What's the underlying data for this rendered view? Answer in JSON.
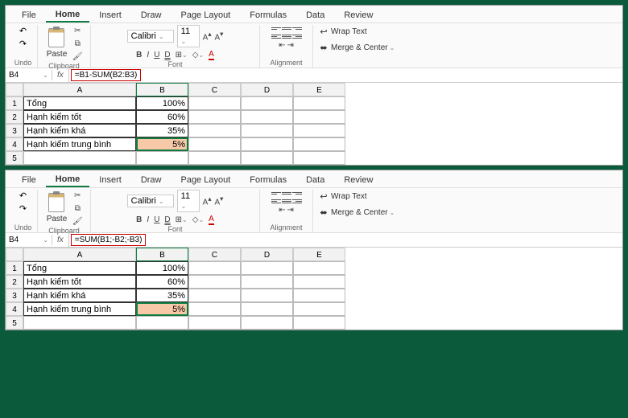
{
  "panels": [
    {
      "tabs": {
        "file": "File",
        "home": "Home",
        "insert": "Insert",
        "draw": "Draw",
        "layout": "Page Layout",
        "formulas": "Formulas",
        "data": "Data",
        "review": "Review"
      },
      "ribbon": {
        "undo": "Undo",
        "clipboard": "Clipboard",
        "paste": "Paste",
        "font_group": "Font",
        "alignment": "Alignment",
        "font_name": "Calibri",
        "font_size": "11",
        "wrap": "Wrap Text",
        "merge": "Merge & Center"
      },
      "fbar": {
        "namebox": "B4",
        "formula": "=B1-SUM(B2:B3)",
        "fx": "fx"
      },
      "grid": {
        "cols": [
          "A",
          "B",
          "C",
          "D",
          "E"
        ],
        "rows": [
          "1",
          "2",
          "3",
          "4",
          "5"
        ],
        "data": [
          {
            "a": "Tổng",
            "b": "100%"
          },
          {
            "a": "Hạnh kiểm tốt",
            "b": "60%"
          },
          {
            "a": "Hạnh kiểm khá",
            "b": "35%"
          },
          {
            "a": "Hạnh kiểm trung bình",
            "b": "5%"
          }
        ]
      }
    },
    {
      "tabs": {
        "file": "File",
        "home": "Home",
        "insert": "Insert",
        "draw": "Draw",
        "layout": "Page Layout",
        "formulas": "Formulas",
        "data": "Data",
        "review": "Review"
      },
      "ribbon": {
        "undo": "Undo",
        "clipboard": "Clipboard",
        "paste": "Paste",
        "font_group": "Font",
        "alignment": "Alignment",
        "font_name": "Calibri",
        "font_size": "11",
        "wrap": "Wrap Text",
        "merge": "Merge & Center"
      },
      "fbar": {
        "namebox": "B4",
        "formula": "=SUM(B1;-B2;-B3)",
        "fx": "fx"
      },
      "grid": {
        "cols": [
          "A",
          "B",
          "C",
          "D",
          "E"
        ],
        "rows": [
          "1",
          "2",
          "3",
          "4",
          "5"
        ],
        "data": [
          {
            "a": "Tổng",
            "b": "100%"
          },
          {
            "a": "Hạnh kiểm tốt",
            "b": "60%"
          },
          {
            "a": "Hạnh kiểm khá",
            "b": "35%"
          },
          {
            "a": "Hạnh kiểm trung bình",
            "b": "5%"
          }
        ]
      }
    }
  ]
}
